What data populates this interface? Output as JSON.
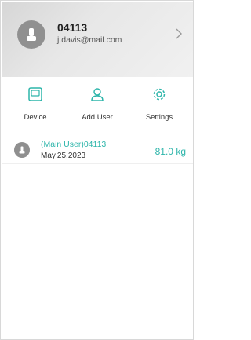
{
  "profile": {
    "name": "04113",
    "email": "j.davis@mail.com"
  },
  "actions": [
    {
      "label": "Device",
      "icon": "device-icon"
    },
    {
      "label": "Add User",
      "icon": "add-user-icon"
    },
    {
      "label": "Settings",
      "icon": "settings-icon"
    }
  ],
  "records": [
    {
      "user": "(Main User)04113",
      "date": "May.25,2023",
      "weight": "81.0 kg"
    }
  ],
  "colors": {
    "accent": "#2db5aa",
    "avatar": "#909090"
  }
}
